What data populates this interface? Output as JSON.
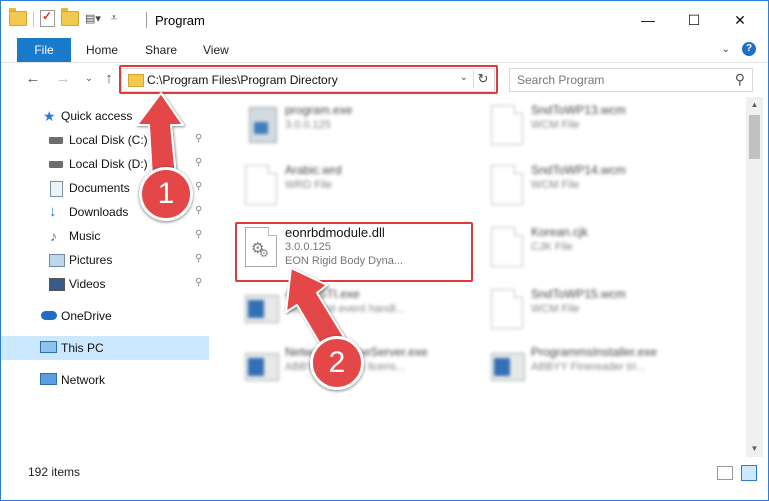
{
  "window": {
    "title": "Program",
    "minimize_glyph": "—",
    "maximize_glyph": "☐",
    "close_glyph": "✕"
  },
  "ribbon": {
    "tabs": [
      "File",
      "Home",
      "Share",
      "View"
    ],
    "expand_glyph": "⌄",
    "help_glyph": "?"
  },
  "nav": {
    "back_glyph": "←",
    "forward_glyph": "→",
    "recent_glyph": "⌄",
    "up_glyph": "↑"
  },
  "address": {
    "path": "C:\\Program Files\\Program Directory",
    "dropdown_glyph": "⌄",
    "refresh_glyph": "↻"
  },
  "search": {
    "placeholder": "Search Program",
    "icon_glyph": "⚲"
  },
  "sidebar": {
    "items": [
      {
        "label": "Quick access",
        "icon": "star-icon",
        "pinned": false
      },
      {
        "label": "Local Disk (C:)",
        "icon": "drive-icon",
        "pinned": true
      },
      {
        "label": "Local Disk (D:)",
        "icon": "drive-icon",
        "pinned": true
      },
      {
        "label": "Documents",
        "icon": "documents-icon",
        "pinned": true
      },
      {
        "label": "Downloads",
        "icon": "download-arrow-icon",
        "pinned": true
      },
      {
        "label": "Music",
        "icon": "music-note-icon",
        "pinned": true
      },
      {
        "label": "Pictures",
        "icon": "pictures-icon",
        "pinned": true
      },
      {
        "label": "Videos",
        "icon": "film-icon",
        "pinned": true
      },
      {
        "label": "OneDrive",
        "icon": "cloud-icon",
        "pinned": false
      },
      {
        "label": "This PC",
        "icon": "monitor-icon",
        "pinned": false,
        "selected": true
      },
      {
        "label": "Network",
        "icon": "network-icon",
        "pinned": false
      }
    ],
    "pin_glyph": "📌"
  },
  "files": [
    {
      "name": "program.exe",
      "line2": "3.0.0.125",
      "line3": "Arabic.wrd",
      "icon": "setup-icon",
      "blurred": true
    },
    {
      "name": "SndToWP13.wcm",
      "line2": "WCM File",
      "line3": "",
      "icon": "document-icon",
      "blurred": true
    },
    {
      "name": "Arabic.wrd",
      "line2": "WRD File",
      "line3": "",
      "icon": "document-icon",
      "blurred": true
    },
    {
      "name": "SndToWP14.wcm",
      "line2": "WCM File",
      "line3": "",
      "icon": "document-icon",
      "blurred": true
    },
    {
      "name": "eonrbdmodule.dll",
      "line2": "3.0.0.125",
      "line3": "EON Rigid Body Dyna...",
      "icon": "dll-gear-icon",
      "blurred": false
    },
    {
      "name": "Korean.cjk",
      "line2": "CJK File",
      "line3": "",
      "icon": "document-icon",
      "blurred": true
    },
    {
      "name": "AbbyySTI.exe",
      "line2": "ABBYY sti event handl...",
      "line3": "",
      "icon": "window-icon",
      "blurred": true
    },
    {
      "name": "SndToWP15.wcm",
      "line2": "WCM File",
      "line3": "",
      "icon": "document-icon",
      "blurred": true
    },
    {
      "name": "NetworkLicenseServer.exe",
      "line2": "ABBYY Network licens...",
      "line3": "",
      "icon": "window-icon",
      "blurred": true
    },
    {
      "name": "ProgrammsInstaller.exe",
      "line2": "ABBYY Finereader tri...",
      "line3": "",
      "icon": "window-icon",
      "blurred": true
    }
  ],
  "status": {
    "items_count": "192 items"
  },
  "markers": {
    "step1": "1",
    "step2": "2"
  },
  "colors": {
    "accent": "#1979ca",
    "highlight": "#e03a3a",
    "selection": "#cce8ff",
    "marker": "#e34747"
  }
}
